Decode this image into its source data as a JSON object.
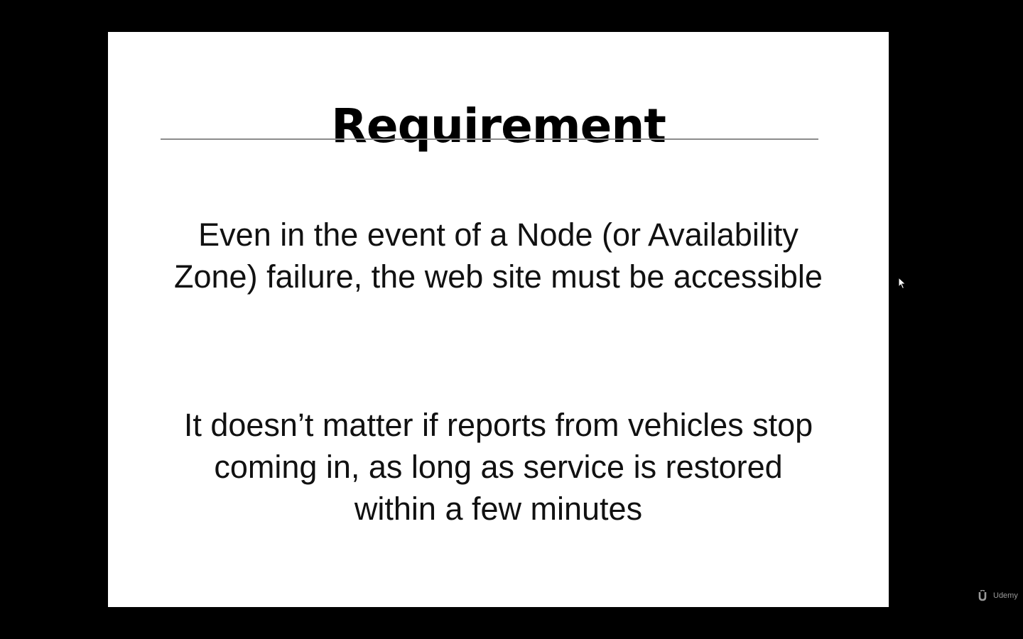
{
  "slide": {
    "title": "Requirement",
    "paragraphs": [
      "Even in the event of a Node (or Availability Zone) failure, the web site must be accessible",
      "It doesn’t matter if reports from vehicles stop coming in, as long as service is restored within a few minutes"
    ]
  },
  "overlay": {
    "cursor_icon": "mouse-pointer-icon",
    "brand_icon": "udemy-logo-icon",
    "brand_text": "Udemy"
  },
  "colors": {
    "background": "#000000",
    "slide": "#ffffff",
    "text": "#111111",
    "rule": "#8c8c8c",
    "brand": "#9a9a9a"
  }
}
